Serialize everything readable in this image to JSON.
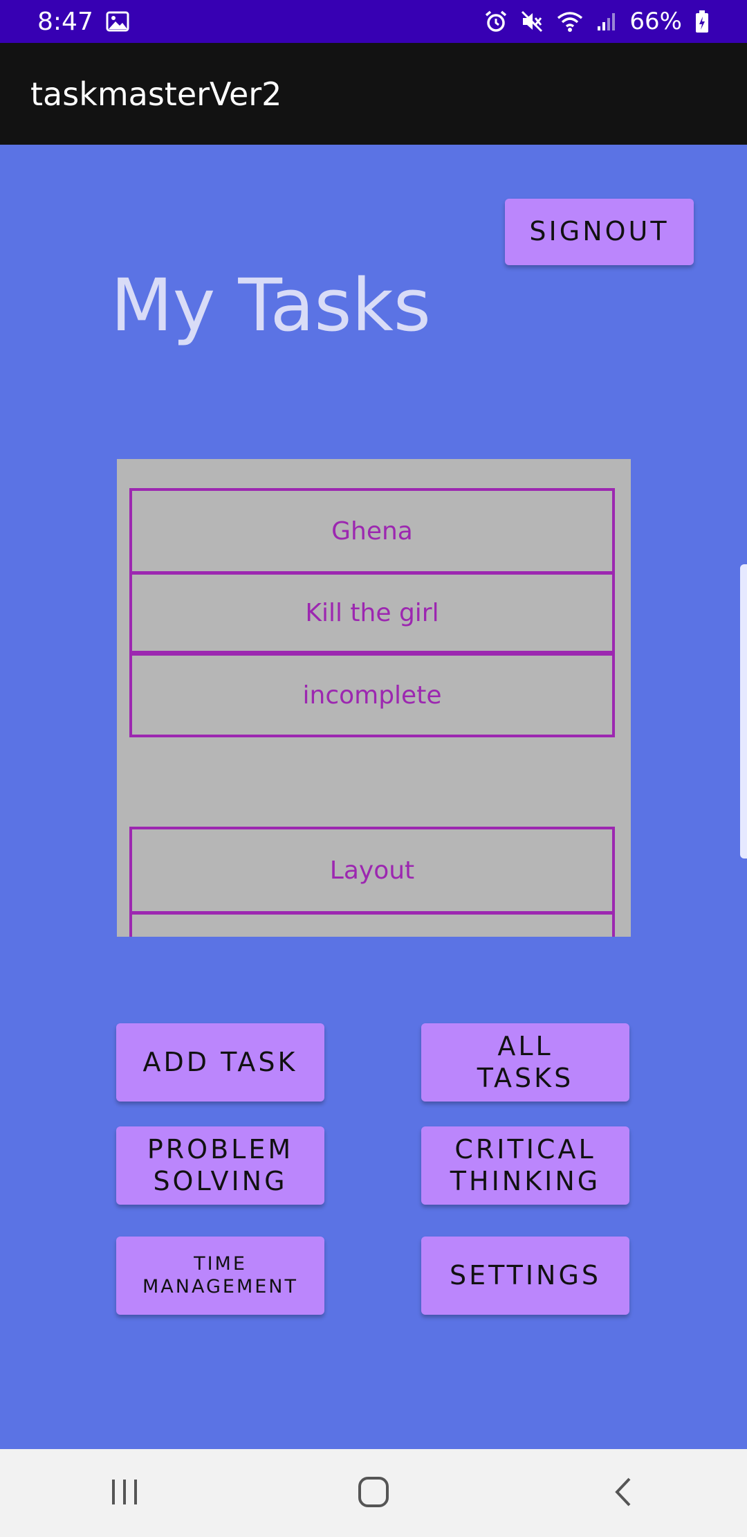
{
  "status_bar": {
    "time": "8:47",
    "battery": "66%",
    "icons": [
      "image-icon",
      "alarm-icon",
      "mute-icon",
      "wifi-icon",
      "signal-icon",
      "battery-icon"
    ]
  },
  "app_bar": {
    "title": "taskmasterVer2"
  },
  "main": {
    "signout_label": "SIGNOUT",
    "title": "My Tasks",
    "tasks": [
      {
        "title": "Ghena"
      },
      {
        "title": "Kill the girl"
      },
      {
        "title": "incomplete"
      },
      {
        "title": ""
      },
      {
        "title": "Layout"
      },
      {
        "title": ""
      }
    ],
    "buttons": {
      "add_task": "ADD TASK",
      "all_tasks_line1": "ALL",
      "all_tasks_line2": "TASKS",
      "problem_solving_line1": "PROBLEM",
      "problem_solving_line2": "SOLVING",
      "critical_thinking_line1": "CRITICAL",
      "critical_thinking_line2": "THINKING",
      "time_management_line1": "TIME",
      "time_management_line2": "MANAGEMENT",
      "settings": "SETTINGS"
    }
  },
  "nav_bar": {
    "icons": [
      "recent-apps-icon",
      "home-icon",
      "back-icon"
    ]
  },
  "colors": {
    "background": "#5b73e4",
    "status_bar": "#3700b3",
    "app_bar": "#121212",
    "button": "#bb86fc",
    "task_border": "#9c27b0",
    "list_background": "#b6b6b6",
    "title_text": "#d9dcf7"
  }
}
